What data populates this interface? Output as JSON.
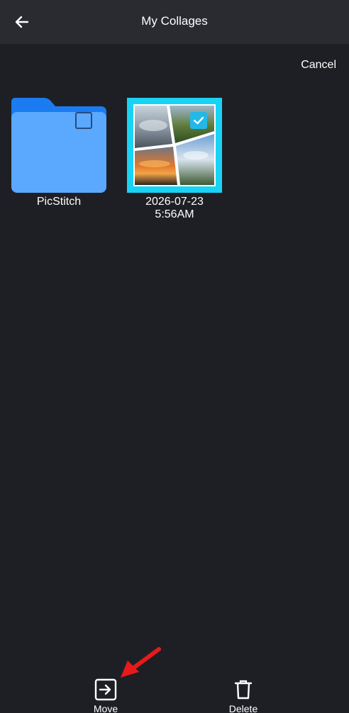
{
  "header": {
    "title": "My Collages"
  },
  "actions": {
    "cancel_label": "Cancel"
  },
  "items": [
    {
      "type": "folder",
      "label": "PicStitch",
      "selected": false
    },
    {
      "type": "collage",
      "label_date": "2026-07-23",
      "label_time": "5:56AM",
      "selected": true
    }
  ],
  "bottom_bar": {
    "move_label": "Move",
    "delete_label": "Delete"
  },
  "colors": {
    "background": "#1e1f25",
    "topbar": "#2a2b31",
    "folder": "#5ba8ff",
    "folder_tab": "#1a7cf0",
    "selection_border": "#19d3f5",
    "checkbox_selected": "#22b8e8",
    "annotation_arrow": "#e8191a"
  }
}
